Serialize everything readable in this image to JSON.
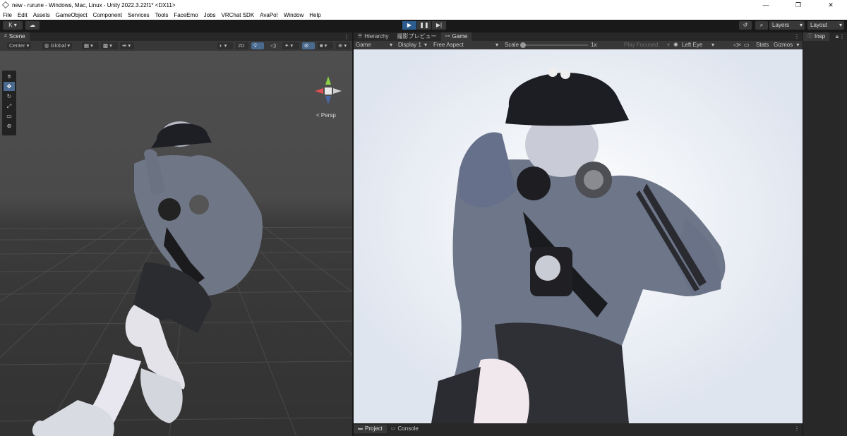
{
  "window": {
    "title": "new - rurune - Windows, Mac, Linux - Unity 2022.3.22f1* <DX11>",
    "controls": [
      "—",
      "❐",
      "✕"
    ]
  },
  "menu": [
    "File",
    "Edit",
    "Assets",
    "GameObject",
    "Component",
    "Services",
    "Tools",
    "FaceEmo",
    "Jobs",
    "VRChat SDK",
    "AvaPo!",
    "Window",
    "Help"
  ],
  "toolbar": {
    "account": "K ▾",
    "layers": "Layers",
    "layout": "Layout"
  },
  "scene": {
    "tab": "Scene",
    "pivot": "Center",
    "space": "Global",
    "mode_2d": "2D",
    "persp": "< Persp"
  },
  "game": {
    "tabs": [
      "Hierarchy",
      "撮影プレビュー",
      "Game"
    ],
    "display_mode": "Game",
    "display": "Display 1",
    "aspect": "Free Aspect",
    "scale_label": "Scale",
    "scale_value": "1x",
    "play_focused": "Play Focused",
    "eye": "Left Eye",
    "stats": "Stats",
    "gizmos": "Gizmos"
  },
  "bottom": {
    "tabs": [
      "Project",
      "Console"
    ]
  },
  "inspector": {
    "tab": "Insp"
  }
}
